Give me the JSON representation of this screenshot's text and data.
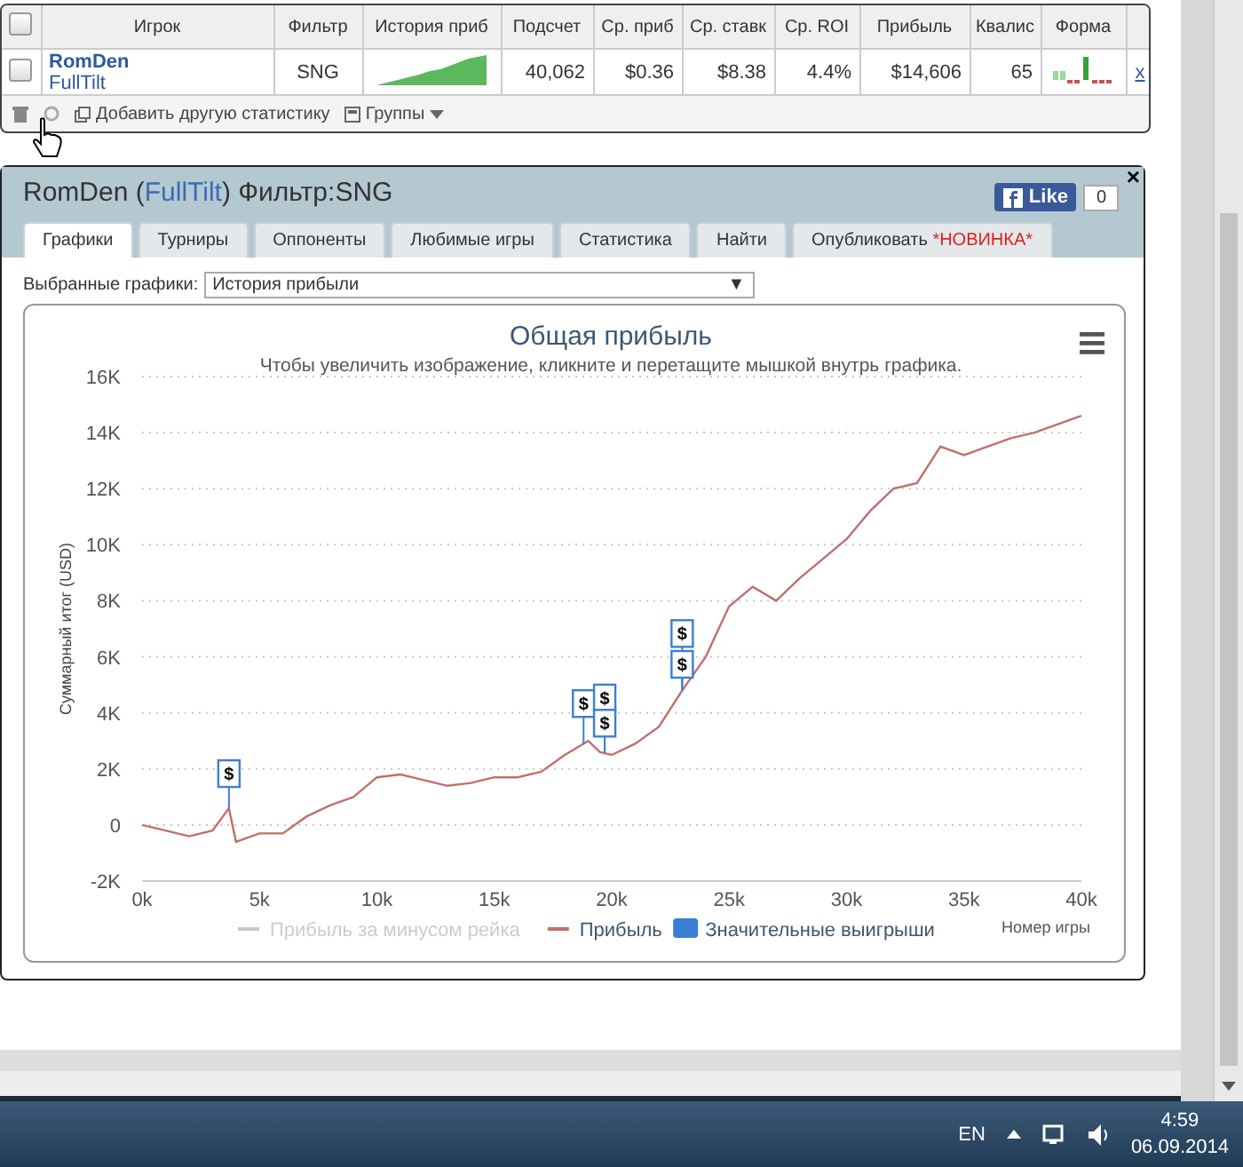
{
  "stats_table": {
    "columns": [
      {
        "kind": "check",
        "checked": false
      },
      {
        "label": "Игрок",
        "kind": "text"
      },
      {
        "label": "Фильтр",
        "kind": "text"
      },
      {
        "label": "История приб",
        "kind": "text"
      },
      {
        "label": "Подсчет",
        "kind": "text"
      },
      {
        "label": "Ср. приб",
        "kind": "text"
      },
      {
        "label": "Ср. ставк",
        "kind": "text"
      },
      {
        "label": "Ср. ROI",
        "kind": "text"
      },
      {
        "label": "Прибыль",
        "kind": "text"
      },
      {
        "label": "Квалис",
        "kind": "text"
      },
      {
        "label": "Форма",
        "kind": "text"
      },
      {
        "kind": "text"
      }
    ],
    "rows": [
      {
        "checked": false,
        "player": "RomDen",
        "site": "FullTilt",
        "filter": "SNG",
        "count": "40,062",
        "avg_profit": "$0.36",
        "avg_stake": "$8.38",
        "roi": "4.4%",
        "profit": "$14,606",
        "qualis": "65",
        "remove": "x"
      }
    ],
    "toolbar": {
      "add_stat": "Добавить другую статистику",
      "groups": "Группы"
    }
  },
  "dialog": {
    "title_before": "RomDen (",
    "title_link": "FullTilt",
    "title_after": ") Фильтр:SNG",
    "like": "Like",
    "like_count": "0",
    "close": "×",
    "tabs": [
      {
        "label": "Графики",
        "selected": true
      },
      {
        "label": "Турниры",
        "selected": false
      },
      {
        "label": "Оппоненты",
        "selected": false
      },
      {
        "label": "Любимые игры",
        "selected": false
      },
      {
        "label": "Статистика",
        "selected": false
      },
      {
        "label": "Найти",
        "selected": false
      },
      {
        "label": "Опубликовать",
        "badge": "*НОВИНКА*",
        "selected": false
      }
    ],
    "chart_select": {
      "label": "Выбранные графики:",
      "value": "История прибыли",
      "arrow": "▼"
    },
    "chart": {
      "subtitle": "Чтобы увеличить изображение, кликните и перетащите мышкой внутрь графика.",
      "chart_data": {
        "type": "line",
        "title": "Общая прибыль",
        "xlabel": "Номер игры",
        "ylabel": "Суммарный итог (USD)",
        "x": [
          0,
          1000,
          2000,
          3000,
          3700,
          4000,
          5000,
          6000,
          7000,
          8000,
          9000,
          10000,
          11000,
          12000,
          13000,
          14000,
          15000,
          16000,
          17000,
          18000,
          19000,
          19500,
          20000,
          21000,
          22000,
          23000,
          24000,
          25000,
          26000,
          27000,
          28000,
          29000,
          30000,
          31000,
          32000,
          33000,
          34000,
          35000,
          36000,
          37000,
          38000,
          39000,
          40000
        ],
        "series": [
          {
            "name": "Прибыль",
            "color": "#c0706c",
            "values": [
              0,
              -200,
              -400,
              -200,
              600,
              -600,
              -300,
              -300,
              300,
              700,
              1000,
              1700,
              1800,
              1600,
              1400,
              1500,
              1700,
              1700,
              1900,
              2500,
              3000,
              2600,
              2500,
              2900,
              3500,
              4800,
              6000,
              7800,
              8500,
              8000,
              8800,
              9500,
              10200,
              11200,
              12000,
              12200,
              13500,
              13200,
              13500,
              13800,
              14000,
              14300,
              14600
            ]
          }
        ],
        "grid": true,
        "xlim": [
          0,
          40000
        ],
        "ylim": [
          -2000,
          16000
        ],
        "xticks": [
          {
            "value": 0,
            "label": "0k"
          },
          {
            "value": 5000,
            "label": "5k"
          },
          {
            "value": 10000,
            "label": "10k"
          },
          {
            "value": 15000,
            "label": "15k"
          },
          {
            "value": 20000,
            "label": "20k"
          },
          {
            "value": 25000,
            "label": "25k"
          },
          {
            "value": 30000,
            "label": "30k"
          },
          {
            "value": 35000,
            "label": "35k"
          },
          {
            "value": 40000,
            "label": "40k"
          }
        ],
        "yticks": [
          {
            "value": -2000,
            "label": "-2K"
          },
          {
            "value": 0,
            "label": "0"
          },
          {
            "value": 2000,
            "label": "2K"
          },
          {
            "value": 4000,
            "label": "4K"
          },
          {
            "value": 6000,
            "label": "6K"
          },
          {
            "value": 8000,
            "label": "8K"
          },
          {
            "value": 10000,
            "label": "10K"
          },
          {
            "value": 12000,
            "label": "12K"
          },
          {
            "value": 14000,
            "label": "14K"
          },
          {
            "value": 16000,
            "label": "16K"
          }
        ],
        "annotations": [
          {
            "x": 3700,
            "y": 1800,
            "text": "$"
          },
          {
            "x": 18800,
            "y": 4300,
            "text": "$"
          },
          {
            "x": 19700,
            "y": 4500,
            "text": "$"
          },
          {
            "x": 19700,
            "y": 3600,
            "text": "$"
          },
          {
            "x": 23000,
            "y": 6800,
            "text": "$"
          },
          {
            "x": 23000,
            "y": 5700,
            "text": "$"
          }
        ]
      },
      "legend": [
        {
          "label": "Прибыль за минусом рейка",
          "kind": "line",
          "hidden": true,
          "color": "#c8c8c8"
        },
        {
          "kind": "series",
          "hidden": false
        },
        {
          "label": "Значительные выигрыши",
          "kind": "flag",
          "hidden": false,
          "color": "#3a7fd5"
        }
      ]
    }
  },
  "taskbar": {
    "language": "EN",
    "time": "4:59",
    "date": "06.09.2014"
  }
}
